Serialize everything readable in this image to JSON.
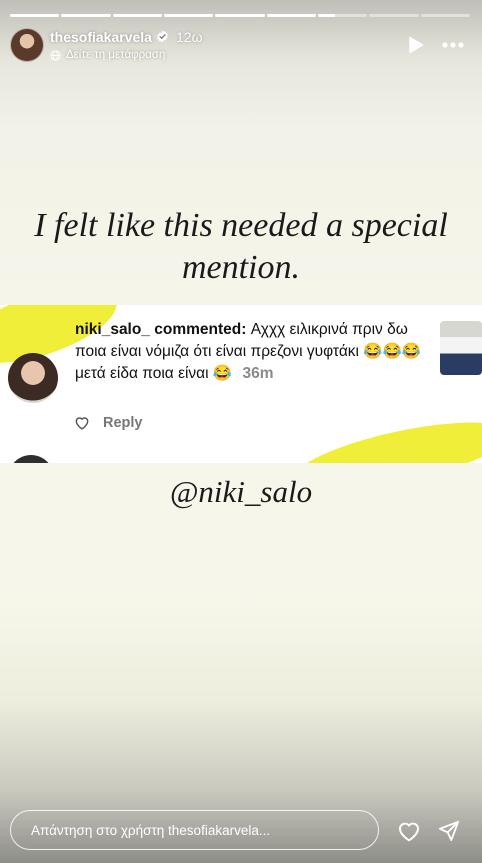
{
  "progress": {
    "segments": [
      1,
      1,
      1,
      1,
      1,
      1,
      0.35,
      0,
      0
    ]
  },
  "header": {
    "username": "thesofiakarvela",
    "time": "12ω",
    "translate": "Δείτε τη μετάφραση"
  },
  "caption": {
    "text": "I felt like this needed a special mention."
  },
  "comment": {
    "user": "niki_salo_",
    "commented": "commented:",
    "body": "Αχχχ ειλικρινά πριν δω ποια είναι νόμιζα ότι είναι πρεζονι γυφτάκι 😂😂😂 μετά είδα ποια είναι 😂",
    "time": "36m",
    "reply": "Reply",
    "accent_color": "#f1ee3a"
  },
  "mention": {
    "text": "@niki_salo"
  },
  "footer": {
    "placeholder": "Απάντηση στο χρήστη thesofiakarvela..."
  },
  "icons": {
    "verified": "verified-badge-icon",
    "globe": "globe-icon",
    "play": "play-icon",
    "more": "more-icon",
    "like": "heart-outline-icon",
    "send": "send-icon"
  }
}
